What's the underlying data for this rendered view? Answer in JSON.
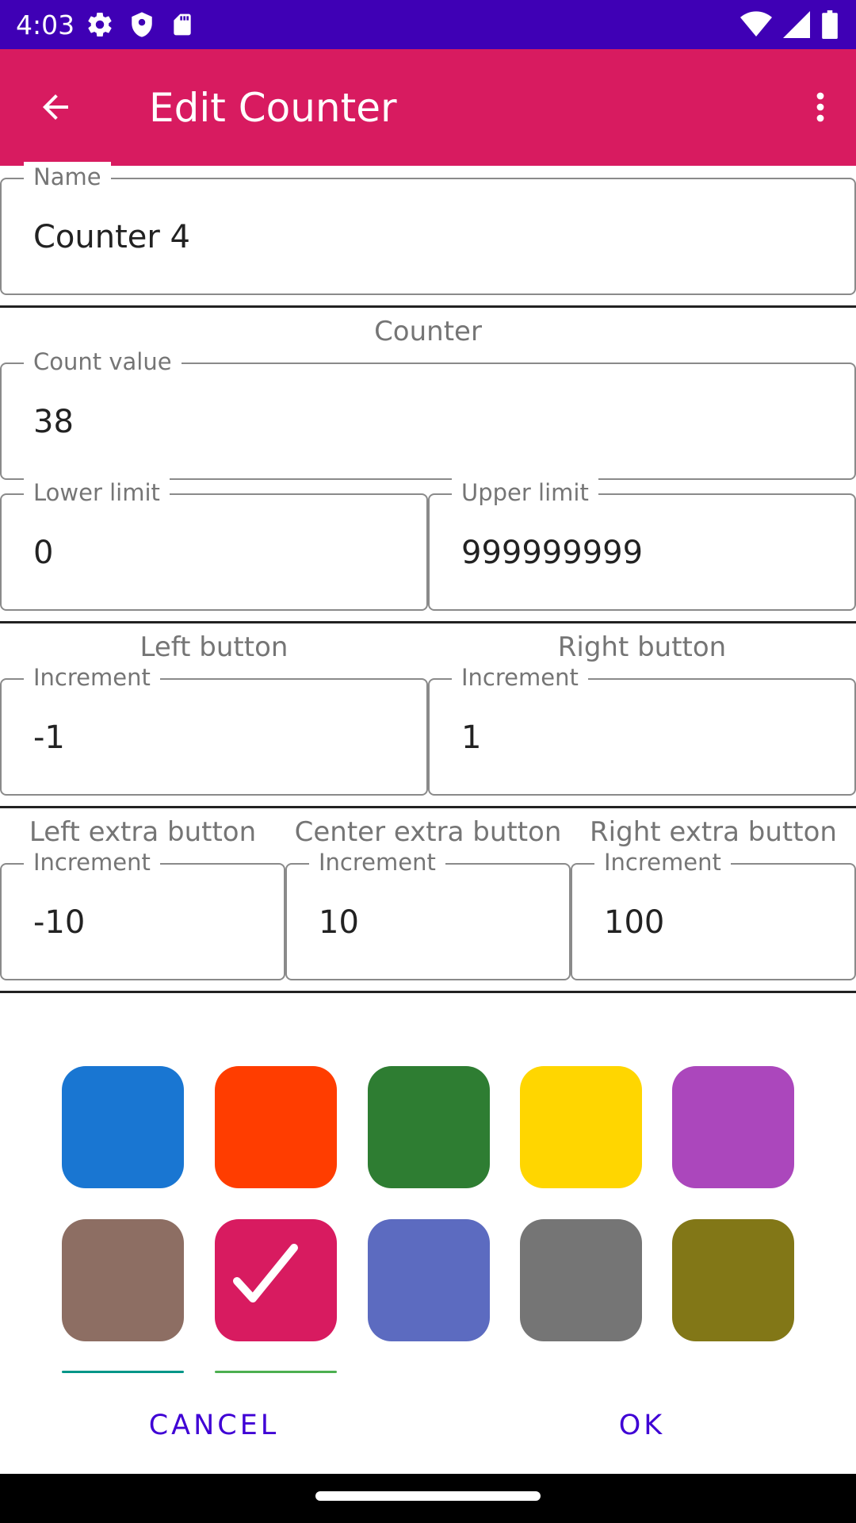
{
  "status_bar": {
    "time": "4:03",
    "icons_left": [
      "gear-icon",
      "shield-icon",
      "sd-card-icon"
    ],
    "icons_right": [
      "wifi-icon",
      "cell-signal-icon",
      "battery-icon"
    ],
    "background": "#3f00b5"
  },
  "app_bar": {
    "title": "Edit Counter",
    "background": "#d81b60"
  },
  "name_field": {
    "label": "Name",
    "value": "Counter 4"
  },
  "counter_section": {
    "title": "Counter",
    "count_value": {
      "label": "Count value",
      "value": "38"
    },
    "lower_limit": {
      "label": "Lower limit",
      "value": "0"
    },
    "upper_limit": {
      "label": "Upper limit",
      "value": "999999999"
    }
  },
  "buttons_section": {
    "left": {
      "title": "Left button",
      "label": "Increment",
      "value": "-1"
    },
    "right": {
      "title": "Right button",
      "label": "Increment",
      "value": "1"
    }
  },
  "extra_section": {
    "left": {
      "title": "Left extra button",
      "label": "Increment",
      "value": "-10"
    },
    "center": {
      "title": "Center extra button",
      "label": "Increment",
      "value": "10"
    },
    "right": {
      "title": "Right extra button",
      "label": "Increment",
      "value": "100"
    }
  },
  "colors": {
    "swatches": [
      "#1976d2",
      "#ff3d00",
      "#2e7d32",
      "#ffd600",
      "#ab47bc",
      "#8d6e63",
      "#d81b60",
      "#5c6bc0",
      "#757575",
      "#827717"
    ],
    "selected": "#d81b60",
    "partial_row": [
      "#009688",
      "#4caf50"
    ]
  },
  "dialog_buttons": {
    "cancel": "CANCEL",
    "ok": "OK",
    "color": "#3f00d5"
  }
}
